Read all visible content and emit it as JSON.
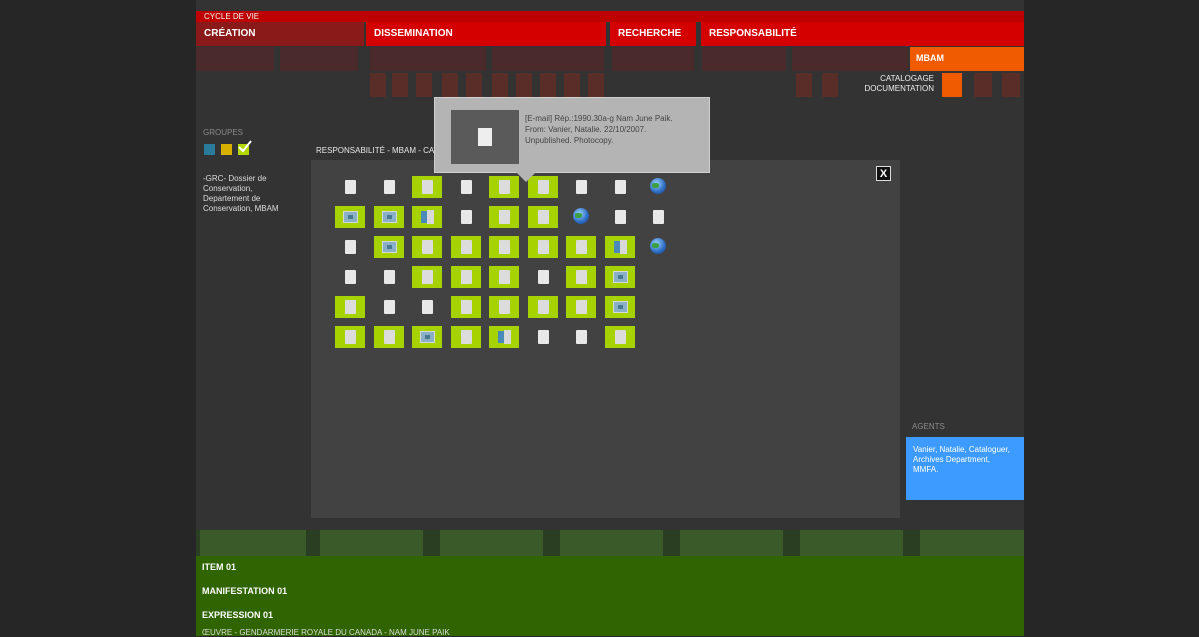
{
  "header": {
    "cycle_label": "CYCLE DE VIE",
    "categories": [
      "CRÉATION",
      "DISSEMINATION",
      "RECHERCHE",
      "RESPONSABILITÉ"
    ],
    "org_tab": "MBAM",
    "sub_labels": [
      "CATALOGAGE",
      "DOCUMENTATION"
    ]
  },
  "groups": {
    "title": "GROUPES",
    "description": "-GRC- Dossier de Conservation, Departement de Conservation, MBAM",
    "swatch_colors": [
      "#2a7a9a",
      "#d8b000",
      "#b0d800"
    ]
  },
  "modal": {
    "title": "RESPONSABILITÉ - MBAM - CAT",
    "close_label": "X",
    "grid": [
      [
        "doc",
        "doc",
        "doc-hl",
        "doc",
        "doc-hl",
        "doc-hl",
        "doc",
        "doc",
        "globe"
      ],
      [
        "img-hl",
        "img-hl",
        "multi-hl",
        "doc",
        "doc-hl",
        "doc-hl",
        "globe",
        "doc",
        "doc"
      ],
      [
        "doc",
        "img-hl",
        "doc-hl",
        "doc-hl",
        "doc-hl",
        "doc-hl",
        "doc-hl",
        "multi-hl",
        "globe"
      ],
      [
        "doc",
        "doc",
        "doc-hl",
        "doc-hl",
        "doc-hl",
        "doc",
        "doc-hl",
        "img-hl"
      ],
      [
        "doc-hl",
        "doc",
        "doc",
        "doc-hl",
        "doc-hl",
        "doc-hl",
        "doc-hl",
        "img-hl"
      ],
      [
        "doc-hl",
        "doc-hl",
        "img-hl",
        "doc-hl",
        "multi-hl",
        "doc",
        "doc",
        "doc-hl"
      ]
    ]
  },
  "tooltip": {
    "line1": "[E-mail] Rép.:1990.30a-g Nam June Paik.",
    "line2": "From: Vanier, Natalie. 22/10/2007.",
    "line3": "Unpublished. Photocopy."
  },
  "agents": {
    "title": "AGENTS",
    "text": "Vanier, Natalie, Cataloguer, Archives Department, MMFA."
  },
  "bottom": {
    "items": [
      "ITEM 01",
      "MANIFESTATION 01",
      "EXPRESSION 01",
      "ŒUVRE - GENDARMERIE ROYALE DU CANADA - NAM JUNE PAIK"
    ]
  },
  "colors": {
    "accent_red": "#d40000",
    "accent_orange": "#f05a00",
    "highlight_green": "#a6d300",
    "agent_blue": "#3d9bff",
    "bottom_green": "#2f6400"
  }
}
